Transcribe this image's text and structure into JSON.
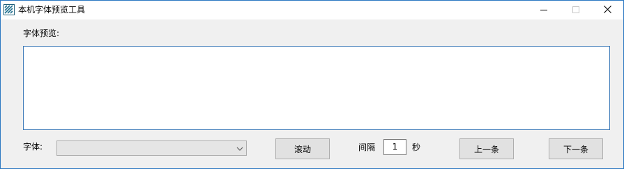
{
  "window": {
    "title": "本机字体预览工具",
    "icons": {
      "app": "app-icon",
      "minimize": "minimize-icon",
      "maximize": "maximize-icon",
      "close": "close-icon"
    }
  },
  "preview": {
    "label": "字体预览:",
    "text": ""
  },
  "controls": {
    "font_label": "字体:",
    "font_value": "",
    "scroll_button": "滚动",
    "interval_label": "间隔",
    "interval_value": "1",
    "seconds_label": "秒",
    "prev_button": "上一条",
    "next_button": "下一条"
  },
  "colors": {
    "window_border": "#2b78c2",
    "text_box_border": "#3d7ab8",
    "button_face": "#e1e1e1",
    "disabled_combo": "#e5e5e5"
  }
}
